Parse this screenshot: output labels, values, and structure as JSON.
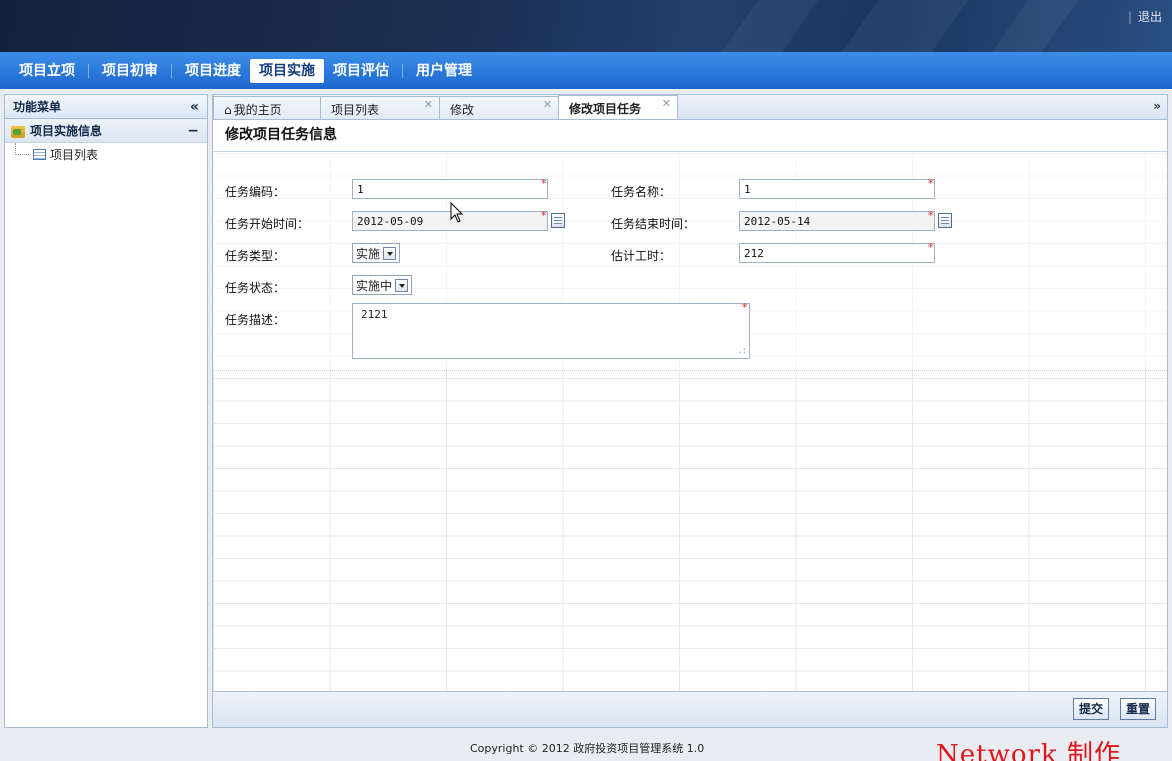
{
  "header": {
    "logout_label": "退出"
  },
  "nav": {
    "items": [
      {
        "label": "项目立项"
      },
      {
        "label": "项目初审"
      },
      {
        "label": "项目进度"
      },
      {
        "label": "项目实施"
      },
      {
        "label": "项目评估"
      },
      {
        "label": "用户管理"
      }
    ],
    "active_index": 3
  },
  "sidebar": {
    "title": "功能菜单",
    "collapse_icon": "double-chevron-left-icon",
    "group": {
      "label": "项目实施信息",
      "toggle": "−"
    },
    "items": [
      {
        "label": "项目列表"
      }
    ]
  },
  "tabs": {
    "items": [
      {
        "label": "我的主页",
        "closable": false
      },
      {
        "label": "项目列表",
        "closable": true
      },
      {
        "label": "修改",
        "closable": true
      },
      {
        "label": "修改项目任务",
        "closable": true
      }
    ],
    "active_index": 3,
    "more_icon": "double-chevron-down-icon"
  },
  "form": {
    "title": "修改项目任务信息",
    "task_code": {
      "label": "任务编码：",
      "value": "1"
    },
    "task_name": {
      "label": "任务名称：",
      "value": "1"
    },
    "start_time": {
      "label": "任务开始时间：",
      "value": "2012-05-09"
    },
    "end_time": {
      "label": "任务结束时间：",
      "value": "2012-05-14"
    },
    "task_type": {
      "label": "任务类型：",
      "value": "实施"
    },
    "est_hours": {
      "label": "估计工时：",
      "value": "212"
    },
    "task_status": {
      "label": "任务状态：",
      "value": "实施中"
    },
    "description": {
      "label": "任务描述：",
      "value": "2121"
    },
    "required_mark": "*"
  },
  "actions": {
    "submit_label": "提交",
    "reset_label": "重置"
  },
  "footer": {
    "copyright": "Copyright © 2012 政府投资项目管理系统 1.0"
  },
  "watermark": "Network 制作",
  "colors": {
    "nav_blue": "#1d67cf",
    "required_red": "#e02020"
  }
}
